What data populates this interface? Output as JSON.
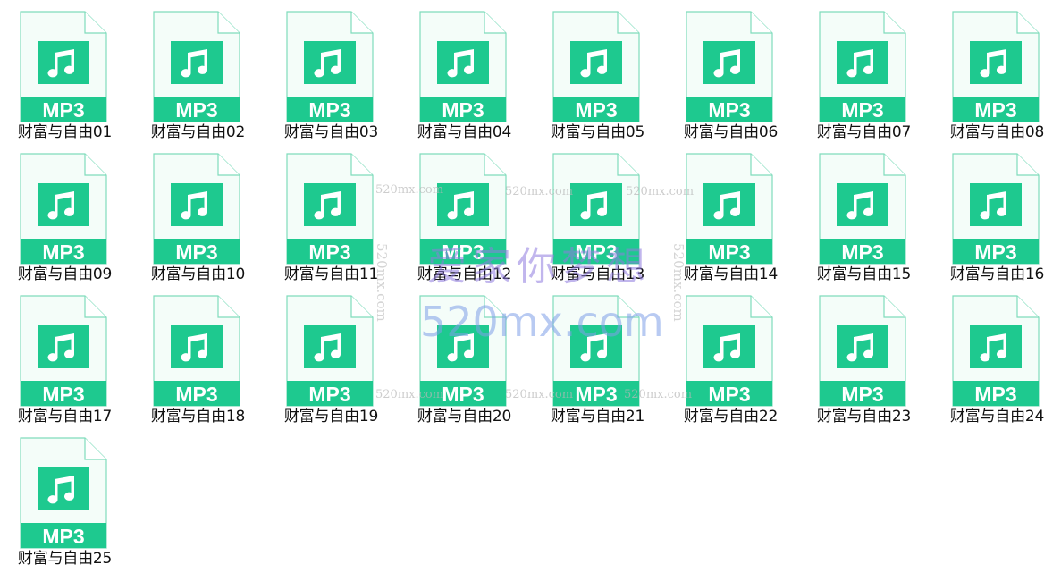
{
  "colors": {
    "badge": "#1ec98f",
    "page_outline": "#7fdcbc",
    "page_fill": "#f4fdf9",
    "label_text": "#111111"
  },
  "icon": "music-note-icon",
  "badge_text": "MP3",
  "files": [
    {
      "name": "财富与自由01"
    },
    {
      "name": "财富与自由02"
    },
    {
      "name": "财富与自由03"
    },
    {
      "name": "财富与自由04"
    },
    {
      "name": "财富与自由05"
    },
    {
      "name": "财富与自由06"
    },
    {
      "name": "财富与自由07"
    },
    {
      "name": "财富与自由08"
    },
    {
      "name": "财富与自由09"
    },
    {
      "name": "财富与自由10"
    },
    {
      "name": "财富与自由11"
    },
    {
      "name": "财富与自由12"
    },
    {
      "name": "财富与自由13"
    },
    {
      "name": "财富与自由14"
    },
    {
      "name": "财富与自由15"
    },
    {
      "name": "财富与自由16"
    },
    {
      "name": "财富与自由17"
    },
    {
      "name": "财富与自由18"
    },
    {
      "name": "财富与自由19"
    },
    {
      "name": "财富与自由20"
    },
    {
      "name": "财富与自由21"
    },
    {
      "name": "财富与自由22"
    },
    {
      "name": "财富与自由23"
    },
    {
      "name": "财富与自由24"
    },
    {
      "name": "财富与自由25"
    }
  ],
  "watermark": {
    "main_cn": "爱家你梦想",
    "main_url": "520mx.com",
    "small": [
      "520mx.com",
      "520mx.com",
      "520mx.com",
      "520mx.com",
      "520mx.com",
      "520mx.com"
    ],
    "vertical": [
      "520mx.com",
      "520mx.com"
    ]
  }
}
